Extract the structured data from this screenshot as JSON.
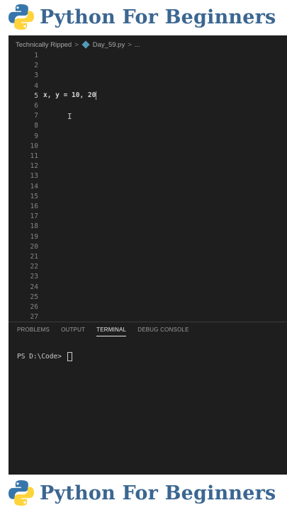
{
  "banner": {
    "title": "Python For Beginners"
  },
  "breadcrumb": {
    "folder": "Technically Ripped",
    "file": "Day_59.py",
    "more": "..."
  },
  "editor": {
    "line_numbers": [
      "1",
      "2",
      "3",
      "4",
      "5",
      "6",
      "7",
      "8",
      "9",
      "10",
      "11",
      "12",
      "13",
      "14",
      "15",
      "16",
      "17",
      "18",
      "19",
      "20",
      "21",
      "22",
      "23",
      "24",
      "25",
      "26",
      "27"
    ],
    "active_line": "5",
    "code_line_5": "x, y = 10, 20"
  },
  "panel": {
    "tabs": [
      "PROBLEMS",
      "OUTPUT",
      "TERMINAL",
      "DEBUG CONSOLE"
    ],
    "active_tab": "TERMINAL",
    "terminal_prompt": "PS D:\\Code> "
  },
  "colors": {
    "editor_bg": "#1e1e1e",
    "banner_text": "#3b6691",
    "python_blue": "#3776ab",
    "python_yellow": "#ffd43b"
  },
  "icons": [
    "python-logo-icon",
    "chevron-right-icon",
    "python-file-icon",
    "text-cursor-icon"
  ]
}
